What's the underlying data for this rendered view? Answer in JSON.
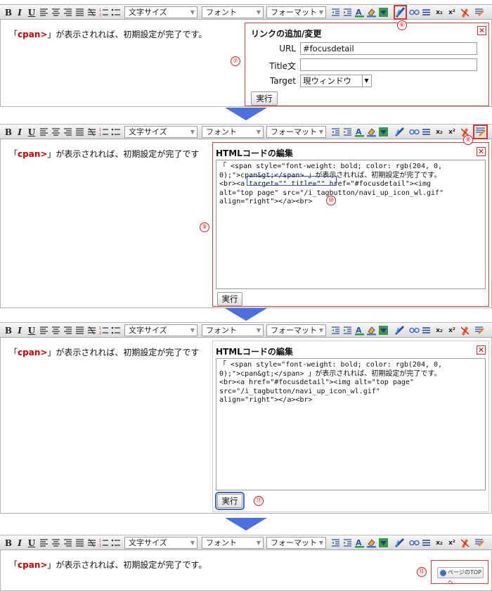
{
  "toolbar": {
    "bold": "B",
    "italic": "I",
    "underline": "U",
    "font_size": "文字サイズ",
    "font": "フォント",
    "format": "フォーマット",
    "subscript": "x₂",
    "superscript": "x²"
  },
  "editor": {
    "prefix": "「",
    "keyword": "cpan>",
    "suffix": "」が表示されれば、初期設定が完了です。",
    "suffix_cut": "」が表示されれば、初期設定が完了です"
  },
  "link_dialog": {
    "title": "リンクの追加/変更",
    "url_label": "URL",
    "url_value": "#focusdetail",
    "title_label": "Title文",
    "title_value": "",
    "target_label": "Target",
    "target_value": "現ウィンドウ",
    "submit": "実行"
  },
  "html_dialog_1": {
    "title": "HTMLコードの編集",
    "code": "「 <span style=\"font-weight: bold; color: rgb(204, 0,\n0);\">cpan&gt;</span> 」が表示されれば、初期設定が完了です。\n<br><a target=\"\" title=\"\" href=\"#focusdetail\"><img\nalt=\"top page\" src=\"/i_tagbutton/navi_up_icon_wl.gif\"\nalign=\"right\"></a><br>",
    "submit": "実行"
  },
  "html_dialog_2": {
    "title": "HTMLコードの編集",
    "code": "「 <span style=\"font-weight: bold; color: rgb(204, 0,\n0);\">cpan&gt;</span> 」が表示されれば、初期設定が完了です。\n<br><a href=\"#focusdetail\"><img alt=\"top page\"\nsrc=\"/i_tagbutton/navi_up_icon_wl.gif\"\nalign=\"right\"></a><br>",
    "submit": "実行"
  },
  "page_top_button": "ページのTOPへ",
  "annotations": {
    "n6": "⑥",
    "n7": "⑦",
    "n8": "⑧",
    "n9": "⑨",
    "n10": "⑩",
    "n11": "⑪",
    "n12": "⑫"
  },
  "colors": {
    "keyword": "#cc0000",
    "annotation": "#e02020",
    "highlight_blue": "#2d55d6",
    "arrow": "#4a6fe0"
  }
}
